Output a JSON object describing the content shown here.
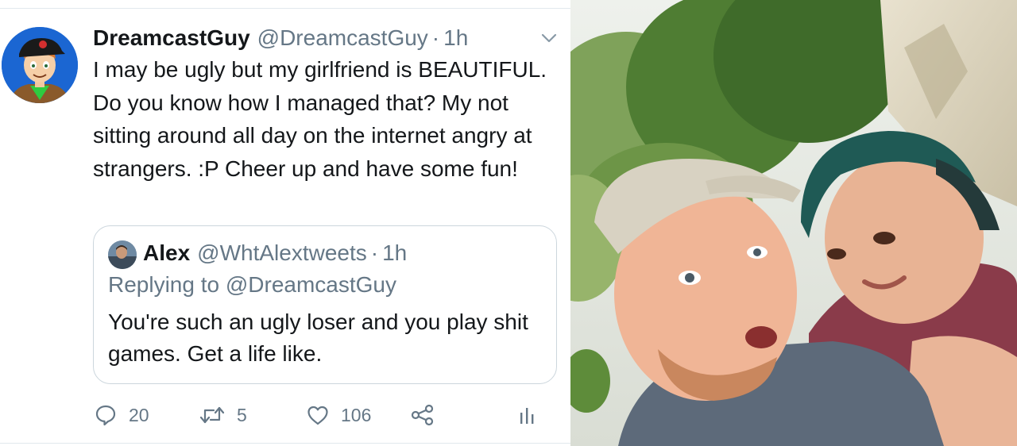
{
  "tweet": {
    "display_name": "DreamcastGuy",
    "handle": "@DreamcastGuy",
    "separator": "·",
    "time": "1h",
    "text": "I may be ugly but my girlfriend is BEAUTIFUL. Do you know how I managed that? My not sitting around all day on the internet angry at strangers. :P Cheer up and have some fun!",
    "avatar_icon": "cartoon-avatar-icon",
    "menu_icon": "chevron-down-icon"
  },
  "quoted_tweet": {
    "display_name": "Alex",
    "handle": "@WhtAlextweets",
    "separator": "·",
    "time": "1h",
    "replying_to": "Replying to @DreamcastGuy",
    "text": "You're such an ugly loser and you play shit games. Get a life like."
  },
  "actions": {
    "reply_count": "20",
    "retweet_count": "5",
    "like_count": "106",
    "share_icon": "share-icon",
    "analytics_icon": "analytics-icon"
  },
  "colors": {
    "text_primary": "#14171a",
    "text_secondary": "#657786",
    "border": "#ccd6dd",
    "divider": "#e1e8ed"
  }
}
